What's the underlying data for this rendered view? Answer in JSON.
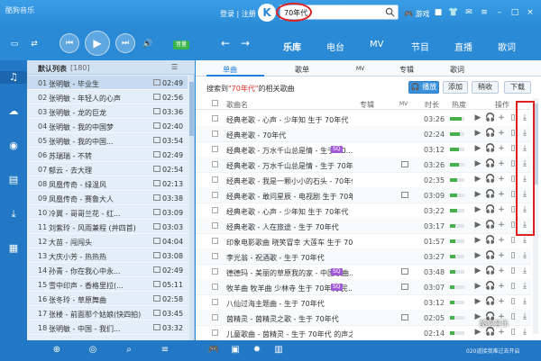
{
  "app": {
    "name": "酷狗音乐"
  },
  "titlebar": {
    "login_label": "登录",
    "sep": "|",
    "register_label": "注册",
    "logo_letter": "K",
    "search_value": "70年代",
    "game_label": "游戏"
  },
  "nav": {
    "tabs": [
      "乐库",
      "电台",
      "MV",
      "节目",
      "直播",
      "歌词"
    ],
    "active_tab": 0,
    "volume_badge": "音量"
  },
  "sidebar": {
    "icons": [
      "music-note-icon",
      "cloud-icon",
      "radio-icon",
      "library-icon",
      "download-icon",
      "apps-grid-icon"
    ],
    "active": 0
  },
  "playlist": {
    "title": "默认列表",
    "count": "[180]",
    "items": [
      {
        "num": "01",
        "name": "张明敏 - 毕业生",
        "duration": "02:49",
        "selected": true
      },
      {
        "num": "02",
        "name": "张明敏 - 年轻人的心声",
        "duration": "02:56"
      },
      {
        "num": "03",
        "name": "张明敏 - 龙的巨龙",
        "duration": "03:36"
      },
      {
        "num": "04",
        "name": "张明敏 - 我的中国梦",
        "duration": "02:40"
      },
      {
        "num": "05",
        "name": "张明敏 - 我的中国...",
        "duration": "03:54"
      },
      {
        "num": "06",
        "name": "苏瑞瑞 - 不转",
        "duration": "02:49"
      },
      {
        "num": "07",
        "name": "郁云 - 去大理",
        "duration": "02:54"
      },
      {
        "num": "08",
        "name": "凤凰传奇 - 绿温风",
        "duration": "02:13"
      },
      {
        "num": "09",
        "name": "凤凰传奇 - 赛鲁大人",
        "duration": "03:38"
      },
      {
        "num": "10",
        "name": "冷翼 - 哥哥兰花 - 红...",
        "duration": "03:09"
      },
      {
        "num": "11",
        "name": "刘紫玲 - 风雨兼程 (并四首)",
        "duration": "03:03"
      },
      {
        "num": "12",
        "name": "大苗 - 闯闯头",
        "duration": "04:04"
      },
      {
        "num": "13",
        "name": "大庆小芳 - 热热热",
        "duration": "03:08"
      },
      {
        "num": "14",
        "name": "孙青 - 你在我心中永...",
        "duration": "02:49"
      },
      {
        "num": "15",
        "name": "雪中印声 - 香格里拉(...",
        "duration": "05:11"
      },
      {
        "num": "16",
        "name": "张冬玲 - 草原舞曲",
        "duration": "02:58"
      },
      {
        "num": "17",
        "name": "张楼 - 前面那个姑娘(快四拍)",
        "duration": "03:45"
      },
      {
        "num": "18",
        "name": "张明敏 - 中国 - 我们...",
        "duration": "03:32"
      }
    ]
  },
  "content": {
    "subtabs": [
      "单曲",
      "歌单",
      "MV",
      "专辑",
      "歌词"
    ],
    "active_subtab": 0,
    "result_prefix": "搜索到",
    "result_query": "\"70年代\"",
    "result_suffix": "的相关歌曲",
    "buttons": {
      "play": "播放",
      "add": "添加",
      "download_list": "稍收",
      "download": "下载"
    },
    "columns": {
      "name": "歌曲名",
      "album": "专辑",
      "mv": "MV",
      "time": "时长",
      "heat": "热度",
      "ops": "操作"
    },
    "rows": [
      {
        "name": "经典老歌 - 心声 - 少年知 生于 70年代",
        "time": "03:26",
        "heat": 0.8
      },
      {
        "name": "经典老歌 - 70年代",
        "time": "02:24",
        "heat": 0.7
      },
      {
        "name": "经典老歌 - 万水千山总是情 - 生于 70...",
        "tag": "SQ",
        "time": "03:12",
        "heat": 0.6
      },
      {
        "name": "经典老歌 - 万水千山总是情 - 生于 70年代",
        "mv": true,
        "time": "03:26",
        "heat": 0.6
      },
      {
        "name": "经典老歌 - 我是一颗小小的石头 - 70年代...",
        "time": "02:35",
        "heat": 0.5
      },
      {
        "name": "经典老歌 - 敢问星辰 - 电视剧 生于 70年代",
        "mv": true,
        "time": "03:09",
        "heat": 0.5
      },
      {
        "name": "经典老歌 - 心声 - 少年知 生于 70年代",
        "time": "03:22",
        "heat": 0.5
      },
      {
        "name": "经典老歌 - 人在旅途 - 生于 70年代",
        "time": "03:17",
        "heat": 0.4
      },
      {
        "name": "印象电影歌曲 晓笑冒幸 大莲车 生于 70年代",
        "time": "01:57",
        "heat": 0.4
      },
      {
        "name": "李光翁 - 祝酒歌 - 生于 70年代",
        "time": "03:27",
        "heat": 0.4
      },
      {
        "name": "德德玛 - 美丽的草原我的家 - 中国歌曲...",
        "tag": "SQ",
        "mv": true,
        "time": "03:48",
        "heat": 0.4
      },
      {
        "name": "牧羊曲 牧羊曲 少林寺 生于 70年代 民...",
        "tag": "SQ",
        "mv": true,
        "time": "03:07",
        "heat": 0.3
      },
      {
        "name": "八仙过海主题曲 - 生于 70年代",
        "time": "03:12",
        "heat": 0.3
      },
      {
        "name": "茵精灵 - 茵精灵之歌 - 生于 70年代",
        "mv": true,
        "time": "02:05",
        "heat": 0.3
      },
      {
        "name": "儿童歌曲 - 茵精灵 - 生于 70年代 的声之家",
        "time": "02:14",
        "heat": 0.3
      }
    ]
  },
  "bottom": {
    "icons": [
      "add-icon",
      "cd-icon",
      "search-icon",
      "game-icon",
      "shop-icon",
      "sun-icon",
      "chart-icon"
    ],
    "status_text": "020道接我难过去开启",
    "watermark": "酷狗音乐"
  }
}
